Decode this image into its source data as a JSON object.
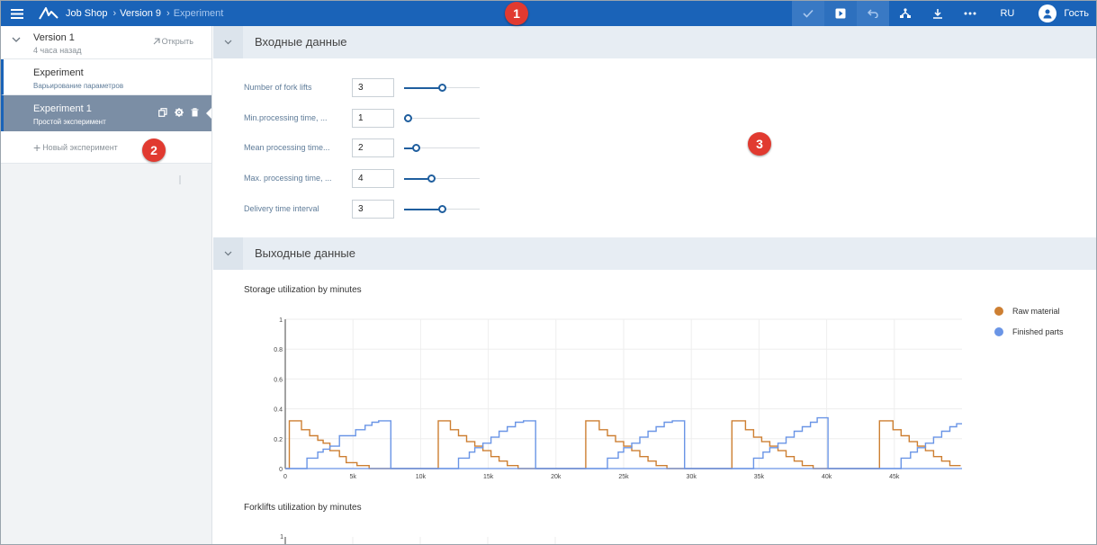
{
  "topbar": {
    "crumbs": [
      "Job Shop",
      "Version 9",
      "Experiment"
    ],
    "lang": "RU",
    "user": "Гость"
  },
  "badges": [
    "1",
    "2",
    "3"
  ],
  "sidebar": {
    "version_title": "Version 1",
    "version_time": "4 часа назад",
    "open_label": "Открыть",
    "experiments": [
      {
        "title": "Experiment",
        "subtitle": "Варьирование параметров"
      },
      {
        "title": "Experiment 1",
        "subtitle": "Простой эксперимент"
      }
    ],
    "new_experiment": "Новый эксперимент"
  },
  "inputs": {
    "title": "Входные данные",
    "params": [
      {
        "label": "Number of fork lifts",
        "value": "3",
        "fraction": 0.5
      },
      {
        "label": "Min.processing time, ...",
        "value": "1",
        "fraction": 0.05
      },
      {
        "label": "Mean processing time...",
        "value": "2",
        "fraction": 0.15
      },
      {
        "label": "Max. processing time, ...",
        "value": "4",
        "fraction": 0.36
      },
      {
        "label": "Delivery time interval",
        "value": "3",
        "fraction": 0.5
      }
    ]
  },
  "outputs": {
    "title": "Выходные данные",
    "chart2_title": "Forklifts utilization by minutes",
    "chart2_first_tick": "1"
  },
  "colors": {
    "accent": "#1a63b8",
    "raw": "#cd7f32",
    "finished": "#6a95e6"
  },
  "chart_data": [
    {
      "type": "line",
      "title": "Storage utilization by minutes",
      "xlabel": "",
      "ylabel": "",
      "xlim": [
        0,
        50000
      ],
      "ylim": [
        0,
        1
      ],
      "x_ticks": [
        0,
        5000,
        10000,
        15000,
        20000,
        25000,
        30000,
        35000,
        40000,
        45000
      ],
      "x_tick_labels": [
        "0",
        "5k",
        "10k",
        "15k",
        "20k",
        "25k",
        "30k",
        "35k",
        "40k",
        "45k"
      ],
      "y_ticks": [
        0,
        0.2,
        0.4,
        0.6,
        0.8,
        1
      ],
      "y_tick_labels": [
        "0",
        "0.2",
        "0.4",
        "0.6",
        "0.8",
        "1"
      ],
      "grid": true,
      "legend": "right",
      "series": [
        {
          "name": "Raw material",
          "color": "#cd7f32",
          "step": true,
          "points": [
            [
              0,
              0
            ],
            [
              300,
              0
            ],
            [
              300,
              0.32
            ],
            [
              1200,
              0.32
            ],
            [
              1200,
              0.26
            ],
            [
              1800,
              0.26
            ],
            [
              1800,
              0.22
            ],
            [
              2400,
              0.22
            ],
            [
              2400,
              0.19
            ],
            [
              2800,
              0.19
            ],
            [
              2800,
              0.17
            ],
            [
              3300,
              0.17
            ],
            [
              3300,
              0.12
            ],
            [
              4000,
              0.12
            ],
            [
              4000,
              0.08
            ],
            [
              4500,
              0.08
            ],
            [
              4500,
              0.04
            ],
            [
              5300,
              0.04
            ],
            [
              5300,
              0.02
            ],
            [
              6200,
              0.02
            ],
            [
              6200,
              0
            ],
            [
              11300,
              0
            ],
            [
              11300,
              0.32
            ],
            [
              12200,
              0.32
            ],
            [
              12200,
              0.26
            ],
            [
              12800,
              0.26
            ],
            [
              12800,
              0.22
            ],
            [
              13400,
              0.22
            ],
            [
              13400,
              0.18
            ],
            [
              14000,
              0.18
            ],
            [
              14000,
              0.15
            ],
            [
              14600,
              0.15
            ],
            [
              14600,
              0.12
            ],
            [
              15200,
              0.12
            ],
            [
              15200,
              0.08
            ],
            [
              15800,
              0.08
            ],
            [
              15800,
              0.05
            ],
            [
              16400,
              0.05
            ],
            [
              16400,
              0.02
            ],
            [
              17200,
              0.02
            ],
            [
              17200,
              0
            ],
            [
              22200,
              0
            ],
            [
              22200,
              0.32
            ],
            [
              23200,
              0.32
            ],
            [
              23200,
              0.26
            ],
            [
              23800,
              0.26
            ],
            [
              23800,
              0.22
            ],
            [
              24400,
              0.22
            ],
            [
              24400,
              0.18
            ],
            [
              25000,
              0.18
            ],
            [
              25000,
              0.15
            ],
            [
              25600,
              0.15
            ],
            [
              25600,
              0.12
            ],
            [
              26200,
              0.12
            ],
            [
              26200,
              0.08
            ],
            [
              26800,
              0.08
            ],
            [
              26800,
              0.05
            ],
            [
              27400,
              0.05
            ],
            [
              27400,
              0.02
            ],
            [
              28200,
              0.02
            ],
            [
              28200,
              0
            ],
            [
              33000,
              0
            ],
            [
              33000,
              0.32
            ],
            [
              34000,
              0.32
            ],
            [
              34000,
              0.26
            ],
            [
              34600,
              0.26
            ],
            [
              34600,
              0.21
            ],
            [
              35200,
              0.21
            ],
            [
              35200,
              0.18
            ],
            [
              35800,
              0.18
            ],
            [
              35800,
              0.15
            ],
            [
              36400,
              0.15
            ],
            [
              36400,
              0.12
            ],
            [
              37000,
              0.12
            ],
            [
              37000,
              0.08
            ],
            [
              37600,
              0.08
            ],
            [
              37600,
              0.05
            ],
            [
              38200,
              0.05
            ],
            [
              38200,
              0.02
            ],
            [
              39000,
              0.02
            ],
            [
              39000,
              0
            ],
            [
              43900,
              0
            ],
            [
              43900,
              0.32
            ],
            [
              44900,
              0.32
            ],
            [
              44900,
              0.26
            ],
            [
              45500,
              0.26
            ],
            [
              45500,
              0.22
            ],
            [
              46100,
              0.22
            ],
            [
              46100,
              0.18
            ],
            [
              46700,
              0.18
            ],
            [
              46700,
              0.15
            ],
            [
              47300,
              0.15
            ],
            [
              47300,
              0.12
            ],
            [
              47900,
              0.12
            ],
            [
              47900,
              0.08
            ],
            [
              48500,
              0.08
            ],
            [
              48500,
              0.05
            ],
            [
              49100,
              0.05
            ],
            [
              49100,
              0.02
            ],
            [
              49900,
              0.02
            ]
          ]
        },
        {
          "name": "Finished parts",
          "color": "#6a95e6",
          "step": true,
          "points": [
            [
              0,
              0
            ],
            [
              1600,
              0
            ],
            [
              1600,
              0.07
            ],
            [
              2400,
              0.07
            ],
            [
              2400,
              0.11
            ],
            [
              2800,
              0.11
            ],
            [
              2800,
              0.13
            ],
            [
              3300,
              0.13
            ],
            [
              3300,
              0.15
            ],
            [
              4000,
              0.15
            ],
            [
              4000,
              0.22
            ],
            [
              5200,
              0.22
            ],
            [
              5200,
              0.26
            ],
            [
              5900,
              0.26
            ],
            [
              5900,
              0.29
            ],
            [
              6400,
              0.29
            ],
            [
              6400,
              0.31
            ],
            [
              6900,
              0.31
            ],
            [
              6900,
              0.32
            ],
            [
              7800,
              0.32
            ],
            [
              7800,
              0
            ],
            [
              12800,
              0
            ],
            [
              12800,
              0.07
            ],
            [
              13600,
              0.07
            ],
            [
              13600,
              0.11
            ],
            [
              14000,
              0.11
            ],
            [
              14000,
              0.14
            ],
            [
              14600,
              0.14
            ],
            [
              14600,
              0.17
            ],
            [
              15200,
              0.17
            ],
            [
              15200,
              0.21
            ],
            [
              15800,
              0.21
            ],
            [
              15800,
              0.25
            ],
            [
              16400,
              0.25
            ],
            [
              16400,
              0.28
            ],
            [
              17000,
              0.28
            ],
            [
              17000,
              0.31
            ],
            [
              17600,
              0.31
            ],
            [
              17600,
              0.32
            ],
            [
              18500,
              0.32
            ],
            [
              18500,
              0
            ],
            [
              23800,
              0
            ],
            [
              23800,
              0.07
            ],
            [
              24600,
              0.07
            ],
            [
              24600,
              0.11
            ],
            [
              25000,
              0.11
            ],
            [
              25000,
              0.14
            ],
            [
              25600,
              0.14
            ],
            [
              25600,
              0.17
            ],
            [
              26200,
              0.17
            ],
            [
              26200,
              0.21
            ],
            [
              26800,
              0.21
            ],
            [
              26800,
              0.25
            ],
            [
              27400,
              0.25
            ],
            [
              27400,
              0.28
            ],
            [
              28000,
              0.28
            ],
            [
              28000,
              0.31
            ],
            [
              28600,
              0.31
            ],
            [
              28600,
              0.32
            ],
            [
              29500,
              0.32
            ],
            [
              29500,
              0
            ],
            [
              34600,
              0
            ],
            [
              34600,
              0.07
            ],
            [
              35300,
              0.07
            ],
            [
              35300,
              0.11
            ],
            [
              35800,
              0.11
            ],
            [
              35800,
              0.14
            ],
            [
              36400,
              0.14
            ],
            [
              36400,
              0.17
            ],
            [
              37000,
              0.17
            ],
            [
              37000,
              0.21
            ],
            [
              37600,
              0.21
            ],
            [
              37600,
              0.25
            ],
            [
              38200,
              0.25
            ],
            [
              38200,
              0.28
            ],
            [
              38800,
              0.28
            ],
            [
              38800,
              0.31
            ],
            [
              39300,
              0.31
            ],
            [
              39300,
              0.34
            ],
            [
              40100,
              0.34
            ],
            [
              40100,
              0
            ],
            [
              45500,
              0
            ],
            [
              45500,
              0.07
            ],
            [
              46200,
              0.07
            ],
            [
              46200,
              0.11
            ],
            [
              46700,
              0.11
            ],
            [
              46700,
              0.14
            ],
            [
              47300,
              0.14
            ],
            [
              47300,
              0.17
            ],
            [
              47900,
              0.17
            ],
            [
              47900,
              0.21
            ],
            [
              48500,
              0.21
            ],
            [
              48500,
              0.25
            ],
            [
              49100,
              0.25
            ],
            [
              49100,
              0.28
            ],
            [
              49600,
              0.28
            ],
            [
              49600,
              0.3
            ],
            [
              50000,
              0.3
            ]
          ]
        }
      ]
    }
  ]
}
